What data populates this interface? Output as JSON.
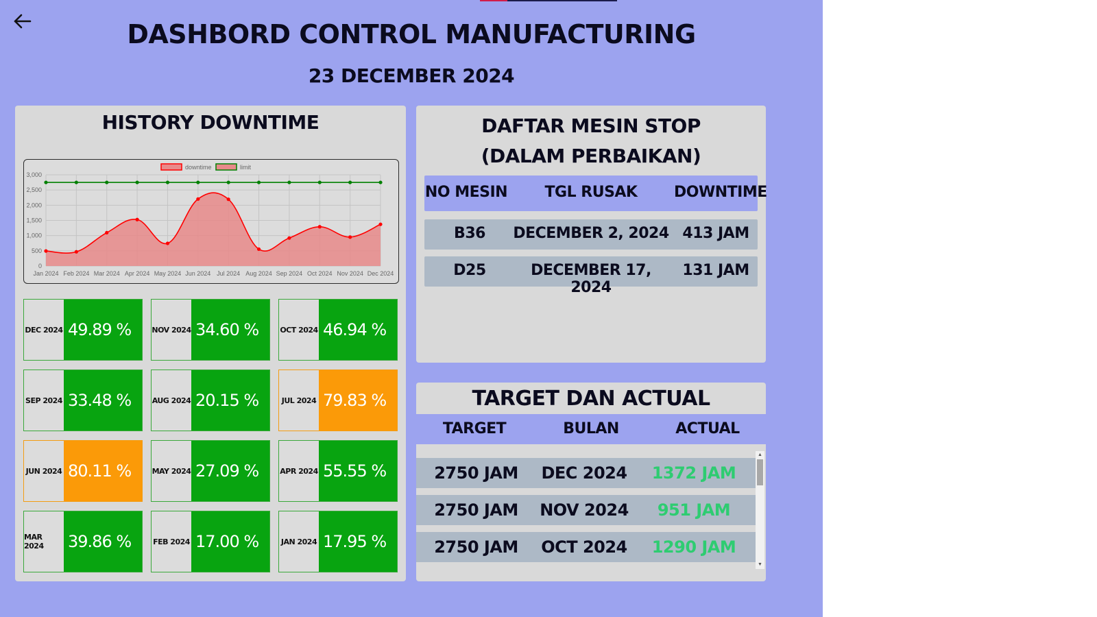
{
  "header": {
    "title": "DASHBORD CONTROL MANUFACTURING",
    "date": "23 DECEMBER 2024"
  },
  "history": {
    "title": "HISTORY DOWNTIME"
  },
  "chart_data": {
    "type": "line",
    "categories": [
      "Jan 2024",
      "Feb 2024",
      "Mar 2024",
      "Apr 2024",
      "May 2024",
      "Jun 2024",
      "Jul 2024",
      "Aug 2024",
      "Sep 2024",
      "Oct 2024",
      "Nov 2024",
      "Dec 2024"
    ],
    "series": [
      {
        "name": "downtime",
        "values": [
          494,
          468,
          1096,
          1528,
          745,
          2203,
          2195,
          554,
          921,
          1291,
          951,
          1372
        ],
        "color": "#ff0000",
        "fill": "#e88a8a"
      },
      {
        "name": "limit",
        "values": [
          2750,
          2750,
          2750,
          2750,
          2750,
          2750,
          2750,
          2750,
          2750,
          2750,
          2750,
          2750
        ],
        "color": "#008000"
      }
    ],
    "yticks": [
      "0",
      "500",
      "1,000",
      "1,500",
      "2,000",
      "2,500",
      "3,000"
    ],
    "ylim": [
      0,
      3000
    ],
    "legend": "top-center",
    "grid": true
  },
  "tiles": [
    {
      "label": "DEC 2024",
      "value": "49.89 %",
      "status": "green"
    },
    {
      "label": "NOV 2024",
      "value": "34.60 %",
      "status": "green"
    },
    {
      "label": "OCT 2024",
      "value": "46.94 %",
      "status": "green"
    },
    {
      "label": "SEP 2024",
      "value": "33.48 %",
      "status": "green"
    },
    {
      "label": "AUG 2024",
      "value": "20.15 %",
      "status": "green"
    },
    {
      "label": "JUL 2024",
      "value": "79.83 %",
      "status": "orange"
    },
    {
      "label": "JUN 2024",
      "value": "80.11 %",
      "status": "orange"
    },
    {
      "label": "MAY 2024",
      "value": "27.09 %",
      "status": "green"
    },
    {
      "label": "APR 2024",
      "value": "55.55 %",
      "status": "green"
    },
    {
      "label": "MAR 2024",
      "value": "39.86 %",
      "status": "green"
    },
    {
      "label": "FEB 2024",
      "value": "17.00 %",
      "status": "green"
    },
    {
      "label": "JAN 2024",
      "value": "17.95 %",
      "status": "green"
    }
  ],
  "tile_colors": {
    "green": "#08a410",
    "orange": "#fb9a08"
  },
  "mesin": {
    "title_line1": "DAFTAR MESIN STOP",
    "title_line2": "(DALAM PERBAIKAN)",
    "headers": {
      "no_mesin": "NO MESIN",
      "tgl_rusak": "TGL RUSAK",
      "downtime": "DOWNTIME"
    },
    "rows": [
      {
        "no_mesin": "B36",
        "tgl_rusak": "DECEMBER 2, 2024",
        "downtime": "413 JAM"
      },
      {
        "no_mesin": "D25",
        "tgl_rusak": "DECEMBER 17, 2024",
        "downtime": "131 JAM"
      }
    ]
  },
  "target": {
    "title": "TARGET DAN ACTUAL",
    "headers": {
      "target": "TARGET",
      "bulan": "BULAN",
      "actual": "ACTUAL"
    },
    "rows": [
      {
        "target": "2750 JAM",
        "bulan": "DEC 2024",
        "actual": "1372 JAM"
      },
      {
        "target": "2750 JAM",
        "bulan": "NOV 2024",
        "actual": "951 JAM"
      },
      {
        "target": "2750 JAM",
        "bulan": "OCT 2024",
        "actual": "1290 JAM"
      }
    ],
    "actual_color": "#2ecc71"
  },
  "icons": {
    "back": "arrow-left-icon"
  }
}
